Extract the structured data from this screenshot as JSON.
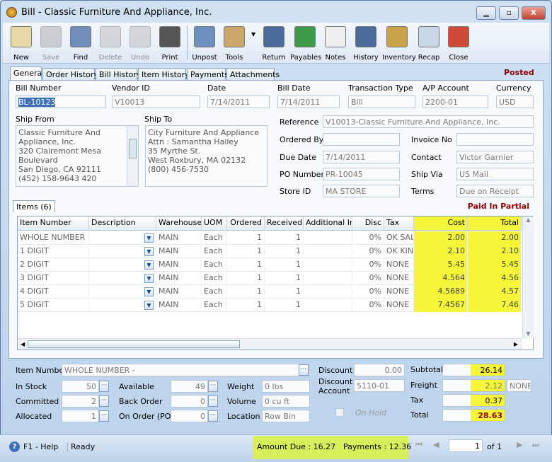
{
  "window": {
    "title": "Bill - Classic Furniture And Appliance, Inc.",
    "minimize": "▁",
    "maximize": "▫",
    "close": "X"
  },
  "toolbar": [
    {
      "label": "New",
      "icon": "new-bill-icon",
      "disabled": false
    },
    {
      "label": "Save",
      "icon": "floppy-disk-icon",
      "disabled": true
    },
    {
      "label": "Find",
      "icon": "binoculars-icon",
      "disabled": false
    },
    {
      "label": "Delete",
      "icon": "trash-can-icon",
      "disabled": true
    },
    {
      "label": "Undo",
      "icon": "undo-arrow-icon",
      "disabled": true
    },
    {
      "label": "Print",
      "icon": "printer-icon",
      "disabled": false
    },
    {
      "label": "Unpost",
      "icon": "unpost-icon",
      "disabled": false
    },
    {
      "label": "Tools",
      "icon": "tools-icon",
      "disabled": false
    },
    {
      "label": "Return",
      "icon": "return-icon",
      "disabled": false
    },
    {
      "label": "Payables",
      "icon": "payables-icon",
      "disabled": false
    },
    {
      "label": "Notes",
      "icon": "notes-icon",
      "disabled": false
    },
    {
      "label": "History",
      "icon": "history-icon",
      "disabled": false
    },
    {
      "label": "Inventory",
      "icon": "inventory-boxes-icon",
      "disabled": false
    },
    {
      "label": "Recap",
      "icon": "recap-icon",
      "disabled": false
    },
    {
      "label": "Close",
      "icon": "close-window-icon",
      "disabled": false
    }
  ],
  "tabs": [
    "General",
    "Order History",
    "Bill History",
    "Item History",
    "Payments",
    "Attachments"
  ],
  "status_badge": "Posted",
  "header": {
    "bill_number": {
      "label": "Bill Number",
      "value": "BL-10123"
    },
    "vendor_id": {
      "label": "Vendor ID",
      "value": "V10013"
    },
    "date": {
      "label": "Date",
      "value": "7/14/2011"
    },
    "bill_date": {
      "label": "Bill Date",
      "value": "7/14/2011"
    },
    "transaction_type": {
      "label": "Transaction Type",
      "value": "Bill"
    },
    "ap_account": {
      "label": "A/P Account",
      "value": "2200-01"
    },
    "currency": {
      "label": "Currency",
      "value": "USD"
    }
  },
  "ship_from": {
    "label": "Ship From",
    "value": "Classic Furniture And\nAppliance, Inc.\n320 Clairemont Mesa\nBoulevard\nSan Diego, CA 92111\n(452) 158-9643 420"
  },
  "ship_to": {
    "label": "Ship To",
    "value": "City Furniture And Appliance\nAttn : Samantha Hailey\n35 Myrthe St.\nWest Roxbury, MA 02132\n(800) 456-7530"
  },
  "details": {
    "reference": {
      "label": "Reference",
      "value": "V10013-Classic Furniture And Appliance, Inc."
    },
    "ordered_by": {
      "label": "Ordered By",
      "value": ""
    },
    "invoice_no": {
      "label": "Invoice No",
      "value": ""
    },
    "due_date": {
      "label": "Due Date",
      "value": "7/14/2011"
    },
    "contact": {
      "label": "Contact",
      "value": "Victor Garnier"
    },
    "po_number": {
      "label": "PO Number",
      "value": "PR-10045"
    },
    "ship_via": {
      "label": "Ship Via",
      "value": "US Mail"
    },
    "store_id": {
      "label": "Store ID",
      "value": "MA STORE"
    },
    "terms": {
      "label": "Terms",
      "value": "Due on Receipt"
    }
  },
  "items_tab": "Items (6)",
  "payment_status": "Paid In Partial",
  "grid": {
    "columns": [
      "Item Number",
      "Description",
      "Warehouse",
      "UOM",
      "Ordered",
      "Received",
      "Additional Inf",
      "Disc",
      "Tax",
      "Cost",
      "Total"
    ],
    "rows": [
      [
        "WHOLE NUMBER",
        "",
        "MAIN",
        "Each",
        "1",
        "1",
        "",
        "0%",
        "OK SALES",
        "2.00",
        "2.00"
      ],
      [
        "1 DIGIT",
        "",
        "MAIN",
        "Each",
        "1",
        "1",
        "",
        "0%",
        "OK KING",
        "2.10",
        "2.10"
      ],
      [
        "2 DIGIT",
        "",
        "MAIN",
        "Each",
        "1",
        "1",
        "",
        "0%",
        "NONE",
        "5.45",
        "5.45"
      ],
      [
        "3 DIGIT",
        "",
        "MAIN",
        "Each",
        "1",
        "1",
        "",
        "0%",
        "NONE",
        "4.564",
        "4.56"
      ],
      [
        "4 DIGIT",
        "",
        "MAIN",
        "Each",
        "1",
        "1",
        "",
        "0%",
        "NONE",
        "4.5689",
        "4.57"
      ],
      [
        "5 DIGIT",
        "",
        "MAIN",
        "Each",
        "1",
        "1",
        "",
        "0%",
        "NONE",
        "7.4567",
        "7.46"
      ]
    ]
  },
  "item_info": {
    "item_number": {
      "label": "Item Number",
      "value": "WHOLE NUMBER -"
    },
    "in_stock": {
      "label": "In Stock",
      "value": "50"
    },
    "committed": {
      "label": "Committed",
      "value": "2"
    },
    "allocated": {
      "label": "Allocated",
      "value": "1"
    },
    "available": {
      "label": "Available",
      "value": "49"
    },
    "back_order": {
      "label": "Back Order",
      "value": "0"
    },
    "on_order": {
      "label": "On Order (PO)",
      "value": "0"
    },
    "weight": {
      "label": "Weight",
      "value": "0 lbs"
    },
    "volume": {
      "label": "Volume",
      "value": "0 cu ft"
    },
    "location": {
      "label": "Location",
      "value": "Row  Bin"
    }
  },
  "discount": {
    "label": "Discount",
    "value": "0.00",
    "account_label": "Discount Account",
    "account": "5110-01"
  },
  "on_hold": {
    "label": "On Hold",
    "checked": false
  },
  "totals": {
    "subtotal": {
      "label": "Subtotal",
      "value": "26.14"
    },
    "freight": {
      "label": "Freight",
      "value": "2.12",
      "tax_code": "NONE"
    },
    "tax": {
      "label": "Tax",
      "value": "0.37"
    },
    "total": {
      "label": "Total",
      "value": "28.63"
    }
  },
  "statusbar": {
    "help": "F1 - Help",
    "state": "Ready",
    "amount_due": "Amount Due : 16.27",
    "payments": "Payments : 12.36",
    "page": "1",
    "of": "of  1"
  },
  "colors": {
    "highlight": "#f5f53a",
    "posted": "#8b0000",
    "accent": "#3d6fb6"
  }
}
